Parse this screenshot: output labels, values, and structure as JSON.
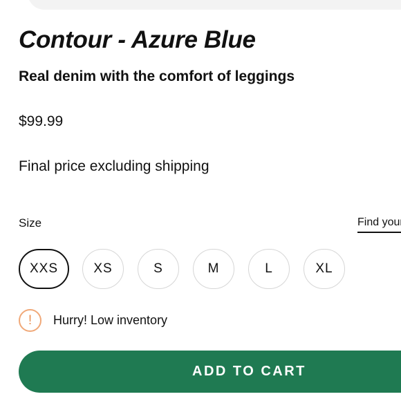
{
  "product": {
    "title": "Contour - Azure Blue",
    "subtitle": "Real denim with the comfort of leggings",
    "price": "$99.99",
    "price_note": "Final price excluding shipping"
  },
  "size_selector": {
    "label": "Size",
    "guide_link": "Find your",
    "options": [
      "XXS",
      "XS",
      "S",
      "M",
      "L",
      "XL"
    ],
    "selected": "XXS"
  },
  "inventory": {
    "icon": "exclamation-icon",
    "icon_glyph": "!",
    "message": "Hurry! Low inventory"
  },
  "cart": {
    "button_label": "ADD TO CART"
  },
  "colors": {
    "accent": "#1f7a52",
    "warning": "#eb8f52"
  }
}
